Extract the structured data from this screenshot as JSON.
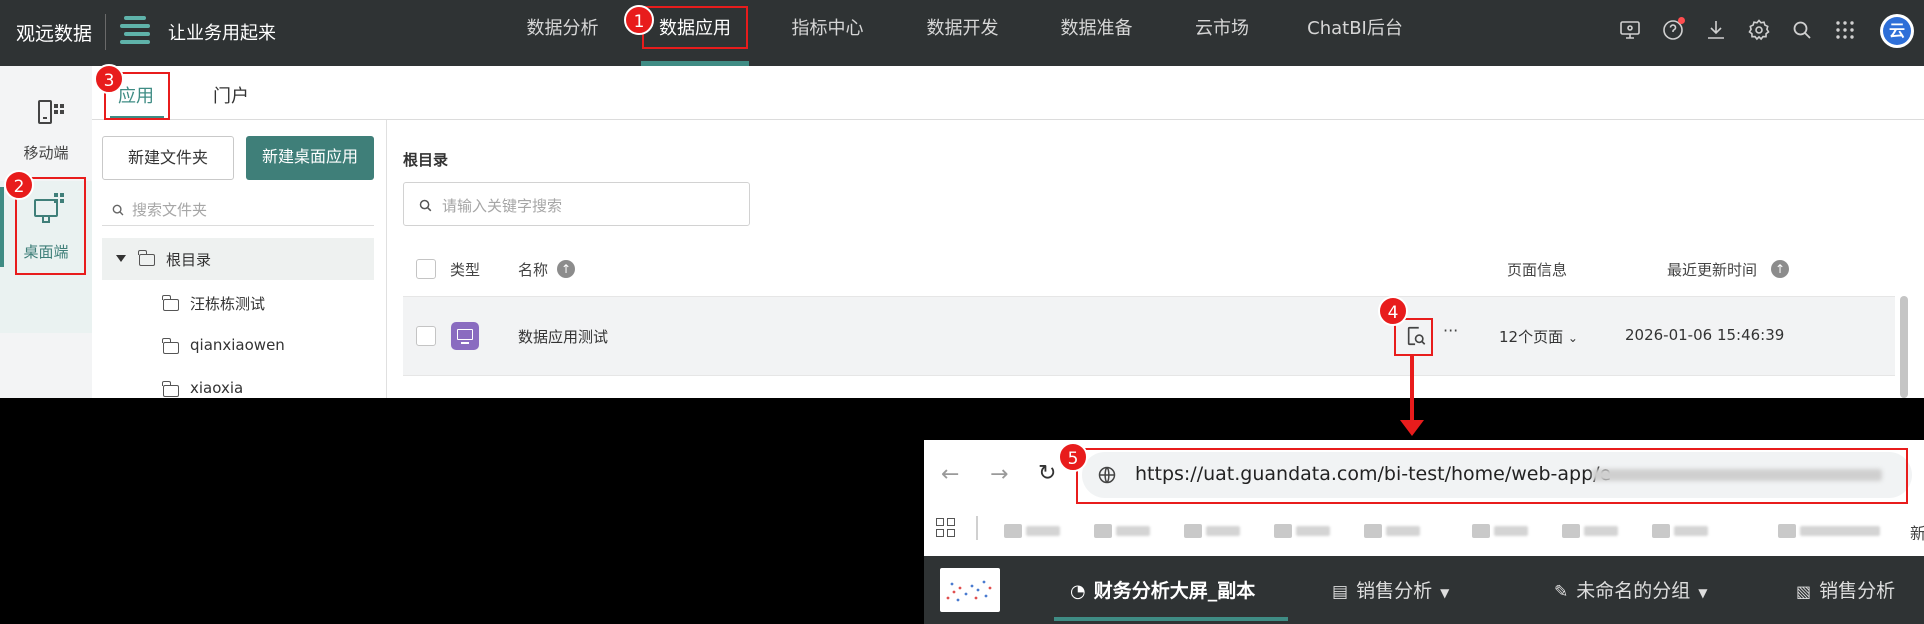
{
  "topnav": {
    "brand": "观远数据",
    "slogan": "让业务用起来",
    "items": [
      "数据分析",
      "数据应用",
      "指标中心",
      "数据开发",
      "数据准备",
      "云市场",
      "ChatBI后台"
    ],
    "active_index": 1,
    "icons": [
      "monitor-settings-icon",
      "help-icon",
      "download-icon",
      "gear-icon",
      "search-icon",
      "apps-grid-icon",
      "user-avatar-icon"
    ],
    "avatar_char": "云"
  },
  "sidebar": {
    "items": [
      {
        "label": "移动端",
        "icon": "mobile-app-icon"
      },
      {
        "label": "桌面端",
        "icon": "desktop-app-icon"
      }
    ],
    "active_index": 1
  },
  "tabs": [
    "应用",
    "门户"
  ],
  "left_panel": {
    "new_folder": "新建文件夹",
    "new_desktop_app": "新建桌面应用",
    "search_placeholder": "搜索文件夹",
    "root": "根目录",
    "folders": [
      "汪栋栋测试",
      "qianxiaowen",
      "xiaoxia"
    ]
  },
  "main": {
    "breadcrumb": "根目录",
    "search_placeholder": "请输入关键字搜索",
    "columns": {
      "type": "类型",
      "name": "名称",
      "pages": "页面信息",
      "updated": "最近更新时间"
    },
    "rows": [
      {
        "name": "数据应用测试",
        "pages": "12个页面",
        "updated": "2026-01-06 15:46:39"
      }
    ],
    "more": "···"
  },
  "badges": [
    "1",
    "2",
    "3",
    "4",
    "5"
  ],
  "browser": {
    "url_visible": "https://uat.guandata.com/bi-test/home/web-app/e",
    "bookmarks_more": "新",
    "tabs": [
      "财务分析大屏_副本",
      "销售分析",
      "未命名的分组",
      "销售分析"
    ]
  },
  "colors": {
    "accent": "#3f8c84",
    "primary_button": "#3f7f79",
    "topbar": "#2f3334",
    "annotation": "#e81c1c",
    "app_icon": "#8a6cc0"
  }
}
